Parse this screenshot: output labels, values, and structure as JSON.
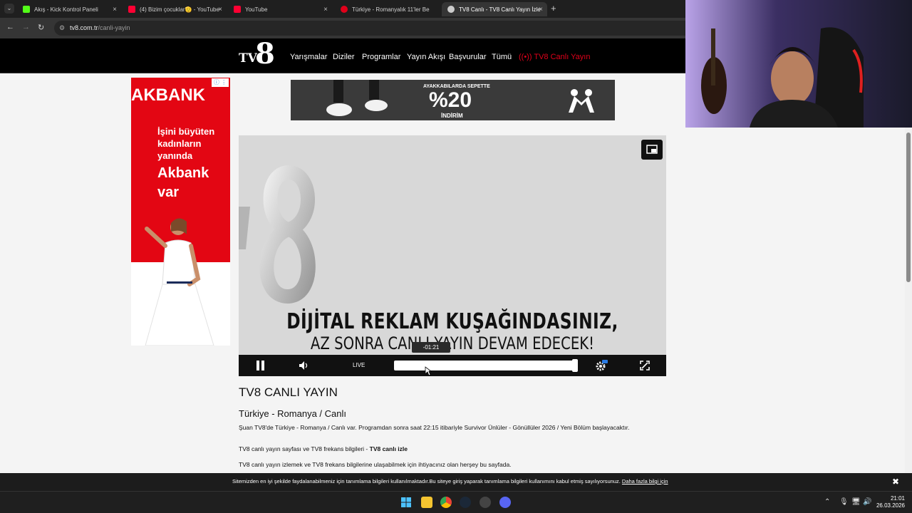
{
  "browser": {
    "tabs": [
      {
        "title": "Akış - Kick Kontrol Paneli",
        "favicon_color": "#53fc18",
        "active": false
      },
      {
        "title": "(4) Bizim çocuklar🫡 - YouTube",
        "favicon_color": "#ff0033",
        "active": false
      },
      {
        "title": "YouTube",
        "favicon_color": "#ff0033",
        "active": false
      },
      {
        "title": "Türkiye - Romanyalık 11'ler Be",
        "favicon_color": "#e0001a",
        "active": false
      },
      {
        "title": "TV8 Canlı - TV8 Canlı Yayın İzle",
        "favicon_color": "#cccccc",
        "active": true
      }
    ],
    "tab_close_glyph": "×",
    "new_tab_glyph": "+",
    "url_domain": "tv8.com.tr",
    "url_path": "/canli-yayin"
  },
  "site": {
    "logo_tv": "TV",
    "logo_8": "8",
    "nav": [
      {
        "label": "Yarışmalar"
      },
      {
        "label": "Diziler"
      },
      {
        "label": "Programlar"
      },
      {
        "label": "Yayın Akışı"
      },
      {
        "label": "Başvurular"
      },
      {
        "label": "Tümü"
      }
    ],
    "nav_live": "((•)) TV8 Canlı Yayın",
    "accent_color": "#e0001a"
  },
  "ads": {
    "akbank": {
      "brand": "AKBANK",
      "copy_lines": [
        "İşini büyüten",
        "kadınların",
        "yanında"
      ],
      "big_lines": [
        "Akbank",
        "var"
      ],
      "adinfo": "ⓘ ⋮"
    },
    "kappa": {
      "line1": "AYAKKABILARDA SEPETTE",
      "line2": "%20",
      "line3": "İNDİRİM"
    }
  },
  "player": {
    "overlay_line1": "DİJİTAL REKLAM KUŞAĞINDASINIZ,",
    "overlay_line2": "AZ SONRA CANLI YAYIN DEVAM EDECEK!",
    "seek_tooltip": "-01:21",
    "live_label": "LIVE",
    "progress_fraction": 0.98
  },
  "article": {
    "title": "TV8 CANLI YAYIN",
    "subtitle": "Türkiye - Romanya / Canlı",
    "p1": "Şuan TV8'de Türkiye - Romanya / Canlı var. Programdan sonra saat 22:15 itibariyle Survivor Ünlüler - Gönüllüler 2026 / Yeni Bölüm başlayacaktır.",
    "p2_text": "TV8 canlı yayın sayfası ve TV8 frekans bilgileri - ",
    "p2_bold": "TV8 canlı izle",
    "p3": "TV8 canlı yayın izlemek ve TV8 frekans bilgilerine ulaşabilmek için ihtiyacınız olan herşey bu sayfada."
  },
  "cookie": {
    "message": "Sitemizden en iyi şekilde faydalanabilmeniz için tanımlama bilgileri kullanılmaktadır.Bu siteye giriş yaparak tanımlama bilgileri kullanımını kabul etmiş sayılıyorsunuz.",
    "more_link": "Daha fazla bilgi için",
    "close": "✖"
  },
  "taskbar": {
    "time": "21:01",
    "date": "26.03.2026"
  }
}
